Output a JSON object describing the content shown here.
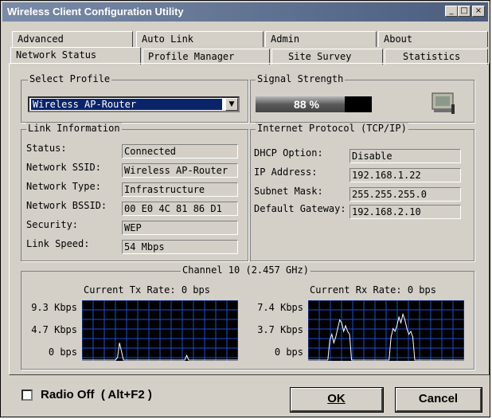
{
  "window": {
    "title": "Wireless Client Configuration Utility",
    "minimize_glyph": "_",
    "maximize_glyph": "□",
    "close_glyph": "×"
  },
  "tabs": {
    "row_back": [
      "Advanced",
      "Auto Link",
      "Admin",
      "About"
    ],
    "row_front": [
      "Network Status",
      "Profile Manager",
      "Site Survey",
      "Statistics"
    ],
    "active": "Network Status"
  },
  "select_profile": {
    "group_label": "Select Profile",
    "selected": "Wireless AP-Router",
    "arrow_glyph": "▼"
  },
  "signal": {
    "group_label": "Signal Strength",
    "value_text": "88 %",
    "level": 0.88
  },
  "link_info": {
    "group_label": "Link Information",
    "fields": [
      {
        "label": "Status:",
        "value": "Connected"
      },
      {
        "label": "Network SSID:",
        "value": "Wireless AP-Router"
      },
      {
        "label": "Network Type:",
        "value": "Infrastructure"
      },
      {
        "label": "Network BSSID:",
        "value": "00 E0 4C 81 86 D1"
      },
      {
        "label": "Security:",
        "value": "WEP"
      },
      {
        "label": "Link Speed:",
        "value": "54 Mbps"
      }
    ]
  },
  "tcpip": {
    "group_label": "Internet Protocol (TCP/IP)",
    "fields": [
      {
        "label": "DHCP Option:",
        "value": "Disable"
      },
      {
        "label": "IP Address:",
        "value": "192.168.1.22"
      },
      {
        "label": "Subnet Mask:",
        "value": "255.255.255.0"
      },
      {
        "label": "Default Gateway:",
        "value": "192.168.2.10"
      }
    ]
  },
  "channel": {
    "group_label": "Channel 10 (2.457 GHz)",
    "tx": {
      "title": "Current Tx Rate: 0 bps",
      "y_labels": [
        "9.3 Kbps",
        "4.7 Kbps",
        "0 bps"
      ],
      "trace": [
        0,
        0,
        0,
        0,
        0,
        0,
        0,
        0,
        0,
        0,
        0,
        0,
        0,
        0,
        0,
        0,
        0,
        0,
        0.05,
        0.3,
        0.15,
        0,
        0,
        0,
        0,
        0,
        0,
        0,
        0,
        0,
        0,
        0,
        0,
        0,
        0,
        0,
        0,
        0,
        0,
        0,
        0,
        0,
        0,
        0,
        0,
        0,
        0,
        0,
        0,
        0,
        0,
        0,
        0,
        0.08,
        0,
        0,
        0,
        0,
        0,
        0,
        0,
        0,
        0,
        0,
        0,
        0,
        0,
        0,
        0,
        0,
        0,
        0,
        0,
        0,
        0,
        0,
        0,
        0,
        0,
        0
      ]
    },
    "rx": {
      "title": "Current Rx Rate: 0 bps",
      "y_labels": [
        "7.4 Kbps",
        "3.7 Kbps",
        "0 bps"
      ],
      "trace": [
        0,
        0,
        0,
        0,
        0,
        0,
        0,
        0,
        0,
        0,
        0,
        0.35,
        0.45,
        0.3,
        0.4,
        0.55,
        0.7,
        0.65,
        0.5,
        0.6,
        0.5,
        0.45,
        0,
        0,
        0,
        0,
        0,
        0,
        0,
        0,
        0,
        0,
        0,
        0,
        0,
        0,
        0,
        0,
        0,
        0,
        0,
        0,
        0.4,
        0.55,
        0.5,
        0.6,
        0.75,
        0.65,
        0.8,
        0.7,
        0.55,
        0.45,
        0.5,
        0.4,
        0,
        0,
        0,
        0,
        0,
        0,
        0,
        0,
        0,
        0,
        0,
        0,
        0,
        0,
        0,
        0,
        0,
        0,
        0,
        0,
        0,
        0,
        0,
        0,
        0,
        0
      ]
    }
  },
  "footer": {
    "radio_off_label": "Radio Off  ( Alt+F2 )",
    "radio_off_checked": false,
    "ok_label": "OK",
    "cancel_label": "Cancel"
  },
  "colors": {
    "selection": "#0a246a",
    "graph_grid": "#1b4fd0",
    "graph_trace": "#ffffff"
  }
}
